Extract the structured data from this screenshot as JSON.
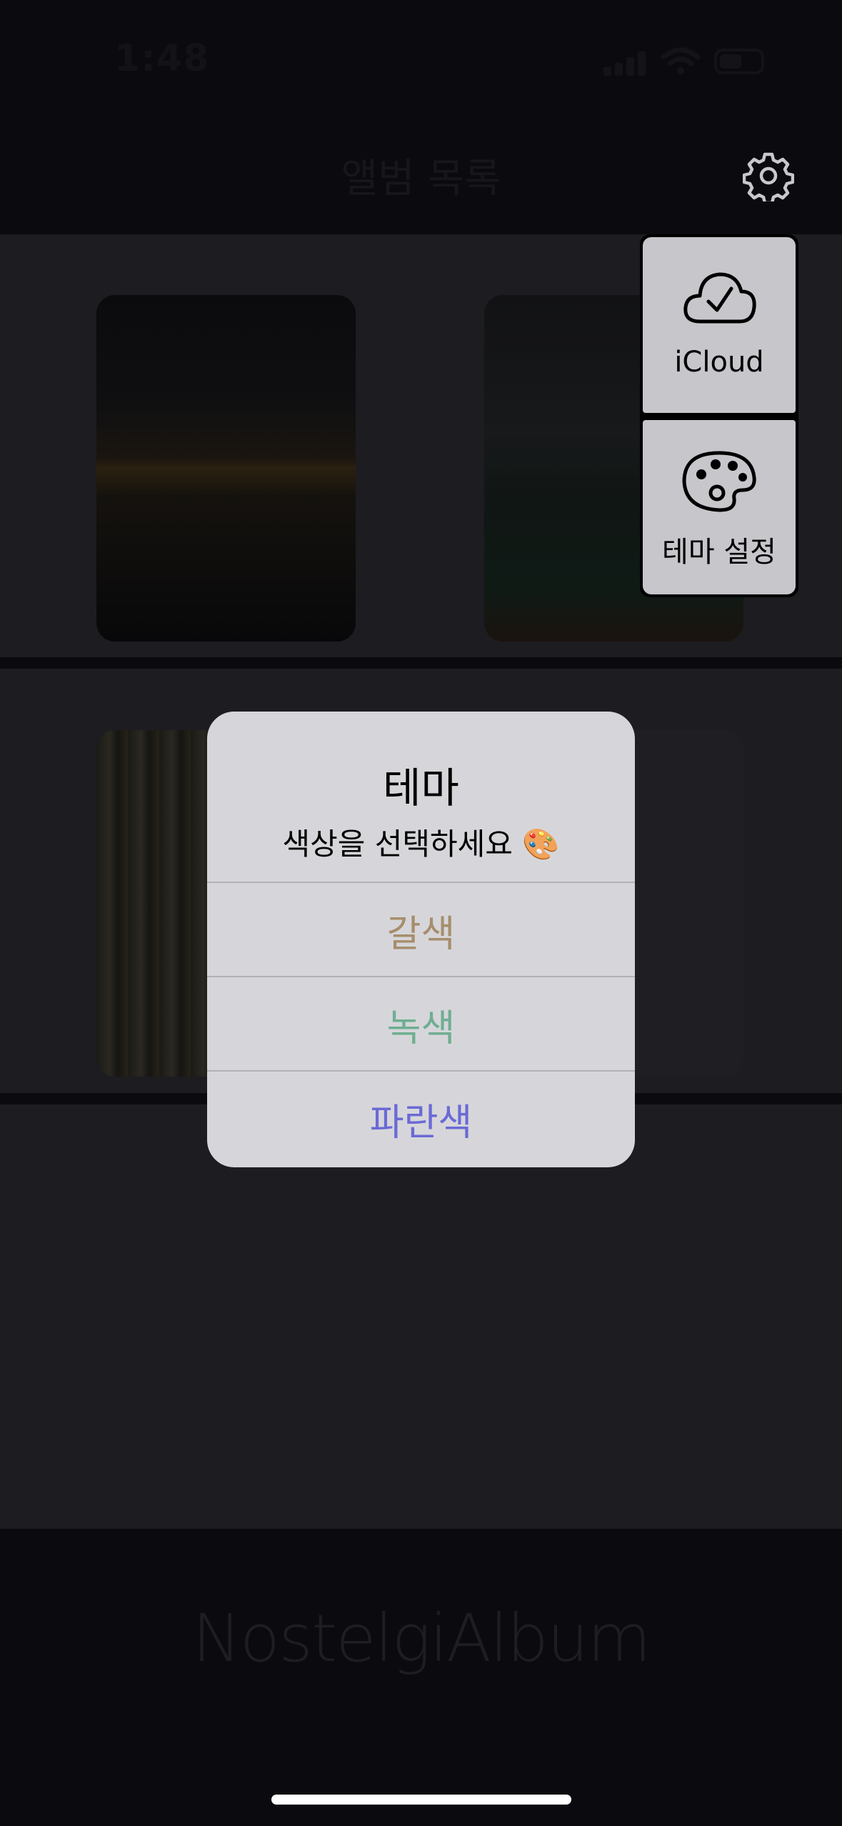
{
  "status_bar": {
    "time": "1:48"
  },
  "nav": {
    "title": "앨범 목록",
    "settings_icon": "gear-icon"
  },
  "albums": [
    {
      "name": "album-night-river"
    },
    {
      "name": "album-field"
    },
    {
      "name": "album-bookshelf"
    },
    {
      "name": "album-empty"
    }
  ],
  "popover_menu": {
    "items": [
      {
        "label": "iCloud",
        "icon": "cloud-check-icon"
      },
      {
        "label": "테마 설정",
        "icon": "palette-icon"
      }
    ]
  },
  "alert": {
    "title": "테마",
    "message": "색상을 선택하세요 🎨",
    "buttons": [
      {
        "label": "갈색",
        "color": "#a68e6c"
      },
      {
        "label": "녹색",
        "color": "#6fae91"
      },
      {
        "label": "파란색",
        "color": "#6a6ad6"
      }
    ]
  },
  "footer": {
    "title": "NostelgiAlbum"
  }
}
